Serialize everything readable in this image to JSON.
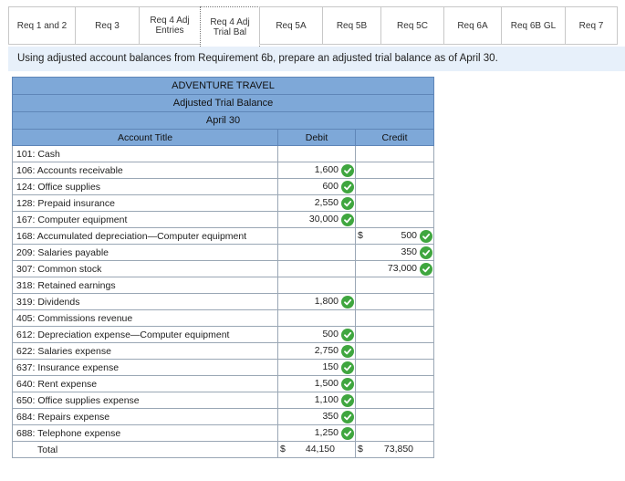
{
  "tabs": [
    {
      "label": "Req 1 and 2",
      "active": false
    },
    {
      "label": "Req 3",
      "active": false
    },
    {
      "label": "Req 4 Adj\nEntries",
      "active": false
    },
    {
      "label": "Req 4 Adj\nTrial Bal",
      "active": true
    },
    {
      "label": "Req 5A",
      "active": false
    },
    {
      "label": "Req 5B",
      "active": false
    },
    {
      "label": "Req 5C",
      "active": false
    },
    {
      "label": "Req 6A",
      "active": false
    },
    {
      "label": "Req 6B GL",
      "active": false
    },
    {
      "label": "Req 7",
      "active": false
    }
  ],
  "instruction": "Using adjusted account balances from Requirement 6b, prepare an adjusted trial balance as of April 30.",
  "table": {
    "company": "ADVENTURE TRAVEL",
    "statement": "Adjusted Trial Balance",
    "date": "April 30",
    "col_account": "Account Title",
    "col_debit": "Debit",
    "col_credit": "Credit",
    "rows": [
      {
        "account": "101: Cash",
        "debit": "",
        "credit": ""
      },
      {
        "account": "106: Accounts receivable",
        "debit": "1,600",
        "credit": ""
      },
      {
        "account": "124: Office supplies",
        "debit": "600",
        "credit": ""
      },
      {
        "account": "128: Prepaid insurance",
        "debit": "2,550",
        "credit": ""
      },
      {
        "account": "167: Computer equipment",
        "debit": "30,000",
        "credit": ""
      },
      {
        "account": "168: Accumulated depreciation—Computer equipment",
        "debit": "",
        "credit": "500",
        "credit_dollar": "$"
      },
      {
        "account": "209: Salaries payable",
        "debit": "",
        "credit": "350"
      },
      {
        "account": "307: Common stock",
        "debit": "",
        "credit": "73,000"
      },
      {
        "account": "318: Retained earnings",
        "debit": "",
        "credit": ""
      },
      {
        "account": "319: Dividends",
        "debit": "1,800",
        "credit": ""
      },
      {
        "account": "405: Commissions revenue",
        "debit": "",
        "credit": ""
      },
      {
        "account": "612: Depreciation expense—Computer equipment",
        "debit": "500",
        "credit": ""
      },
      {
        "account": "622: Salaries expense",
        "debit": "2,750",
        "credit": ""
      },
      {
        "account": "637: Insurance expense",
        "debit": "150",
        "credit": ""
      },
      {
        "account": "640: Rent expense",
        "debit": "1,500",
        "credit": ""
      },
      {
        "account": "650: Office supplies expense",
        "debit": "1,100",
        "credit": ""
      },
      {
        "account": "684: Repairs expense",
        "debit": "350",
        "credit": ""
      },
      {
        "account": "688: Telephone expense",
        "debit": "1,250",
        "credit": ""
      }
    ],
    "total": {
      "label": "Total",
      "debit_dollar": "$",
      "debit": "44,150",
      "credit_dollar": "$",
      "credit": "73,850"
    }
  }
}
